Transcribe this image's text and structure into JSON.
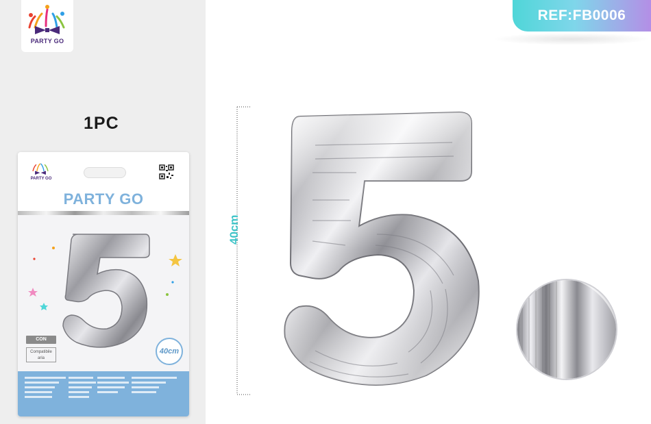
{
  "reference": {
    "text": "REF:FB0006"
  },
  "brand": {
    "name": "PARTY GO"
  },
  "quantity": {
    "text": "1PC"
  },
  "dimension": {
    "text": "40cm"
  },
  "package": {
    "brand": "PARTY GO",
    "size_badge": "40cm",
    "con_label": "CON",
    "compat_label_1": "Compatibile",
    "compat_label_2": "aria",
    "digit": "5"
  },
  "colors": {
    "accent_teal": "#3fc4c8",
    "ref_gradient_start": "#4fd6d8",
    "ref_gradient_end": "#b48ee6",
    "package_blue": "#7fb2dc",
    "foil_silver": "#c8c8cc"
  },
  "icons": {
    "logo": "party-go-logo-icon",
    "qr": "qr-code-icon",
    "star": "star-icon"
  }
}
